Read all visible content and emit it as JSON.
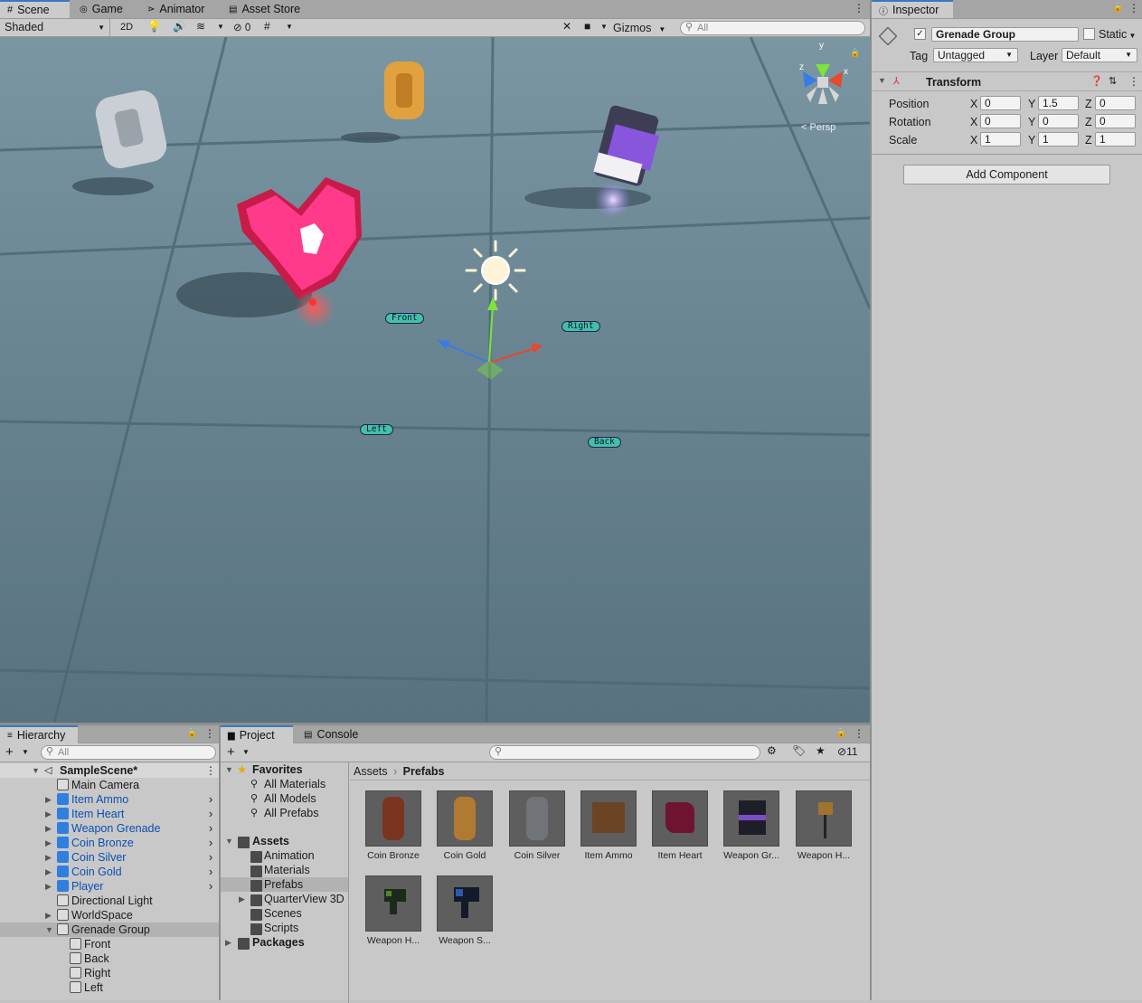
{
  "scene_tabs": [
    {
      "label": "Scene"
    },
    {
      "label": "Game"
    },
    {
      "label": "Animator"
    },
    {
      "label": "Asset Store"
    }
  ],
  "scene_toolbar": {
    "shading": "Shaded",
    "mode_2d": "2D",
    "hidden_count": "0",
    "gizmos": "Gizmos",
    "search_placeholder": "All"
  },
  "scene_view": {
    "persp_label": "Persp",
    "gizmo_axes": {
      "y": "y",
      "x": "x",
      "z": "z"
    },
    "labels": [
      "Front",
      "Right",
      "Left",
      "Back"
    ]
  },
  "inspector": {
    "tab": "Inspector",
    "object_name": "Grenade Group",
    "static_label": "Static",
    "tag_label": "Tag",
    "tag_value": "Untagged",
    "layer_label": "Layer",
    "layer_value": "Default",
    "component": "Transform",
    "rows": [
      {
        "label": "Position",
        "x": "0",
        "y": "1.5",
        "z": "0"
      },
      {
        "label": "Rotation",
        "x": "0",
        "y": "0",
        "z": "0"
      },
      {
        "label": "Scale",
        "x": "1",
        "y": "1",
        "z": "1"
      }
    ],
    "axis_labels": {
      "x": "X",
      "y": "Y",
      "z": "Z"
    },
    "add_component": "Add Component"
  },
  "hierarchy": {
    "tab": "Hierarchy",
    "search_placeholder": "All",
    "scene": "SampleScene*",
    "items": [
      {
        "label": "Main Camera"
      },
      {
        "label": "Item Ammo"
      },
      {
        "label": "Item Heart"
      },
      {
        "label": "Weapon Grenade"
      },
      {
        "label": "Coin Bronze"
      },
      {
        "label": "Coin Silver"
      },
      {
        "label": "Coin Gold"
      },
      {
        "label": "Player"
      },
      {
        "label": "Directional Light"
      },
      {
        "label": "WorldSpace"
      },
      {
        "label": "Grenade Group"
      },
      {
        "label": "Front"
      },
      {
        "label": "Back"
      },
      {
        "label": "Right"
      },
      {
        "label": "Left"
      }
    ]
  },
  "project": {
    "tabs": [
      {
        "label": "Project"
      },
      {
        "label": "Console"
      }
    ],
    "hidden_count": "11",
    "favorites": "Favorites",
    "favorite_items": [
      {
        "label": "All Materials"
      },
      {
        "label": "All Models"
      },
      {
        "label": "All Prefabs"
      }
    ],
    "assets_root": "Assets",
    "folders": [
      {
        "label": "Animation"
      },
      {
        "label": "Materials"
      },
      {
        "label": "Prefabs"
      },
      {
        "label": "QuarterView 3D"
      },
      {
        "label": "Scenes"
      },
      {
        "label": "Scripts"
      }
    ],
    "packages": "Packages",
    "breadcrumb": {
      "root": "Assets",
      "current": "Prefabs"
    },
    "assets": [
      {
        "label": "Coin Bronze"
      },
      {
        "label": "Coin Gold"
      },
      {
        "label": "Coin Silver"
      },
      {
        "label": "Item Ammo"
      },
      {
        "label": "Item Heart"
      },
      {
        "label": "Weapon Gr..."
      },
      {
        "label": "Weapon H..."
      },
      {
        "label": "Weapon H..."
      },
      {
        "label": "Weapon S..."
      }
    ]
  }
}
